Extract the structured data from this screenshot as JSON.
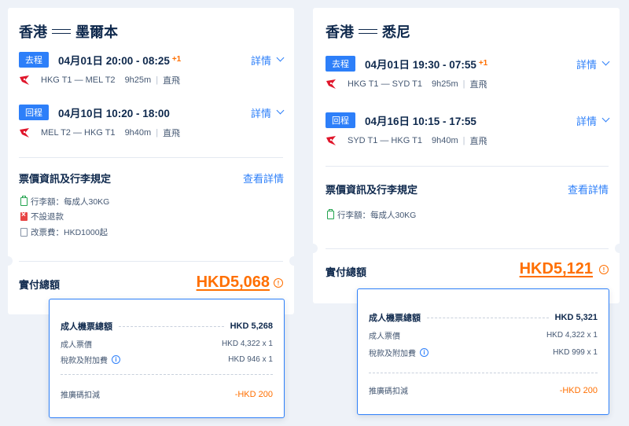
{
  "colors": {
    "accent_blue": "#2d7ff9",
    "price_orange": "#ff6f00",
    "text_dark": "#0f294d",
    "bag_green": "#23a34f",
    "no_refund_red": "#e84545"
  },
  "left": {
    "title_from": "香港",
    "title_to": "墨爾本",
    "segments": [
      {
        "tag": "去程",
        "time": "04月01日 20:00 - 08:25",
        "plus": "+1",
        "details": "詳情",
        "route": "HKG T1 — MEL T2",
        "duration": "9h25m",
        "nonstop": "直飛"
      },
      {
        "tag": "回程",
        "time": "04月10日 10:20 - 18:00",
        "plus": "",
        "details": "詳情",
        "route": "MEL T2 — HKG T1",
        "duration": "9h40m",
        "nonstop": "直飛"
      }
    ],
    "fare_title": "票價資訊及行李規定",
    "view_details": "查看詳情",
    "rules": [
      {
        "icon": "baggage-icon",
        "text": "行李額：每成人30KG"
      },
      {
        "icon": "no-refund-icon",
        "text": "不設退款"
      },
      {
        "icon": "change-fee-icon",
        "text": "改票費：HKD1000起"
      }
    ],
    "total_label": "實付總額",
    "total_amount": "HKD5,068",
    "popup": {
      "head_label": "成人機票總額",
      "head_value": "HKD 5,268",
      "fare_label": "成人票價",
      "fare_value": "HKD 4,322 x 1",
      "tax_label": "稅款及附加費",
      "tax_value": "HKD 946 x 1",
      "discount_label": "推廣碼扣減",
      "discount_value": "-HKD 200"
    }
  },
  "right": {
    "title_from": "香港",
    "title_to": "悉尼",
    "segments": [
      {
        "tag": "去程",
        "time": "04月01日 19:30 - 07:55",
        "plus": "+1",
        "details": "詳情",
        "route": "HKG T1 — SYD T1",
        "duration": "9h25m",
        "nonstop": "直飛"
      },
      {
        "tag": "回程",
        "time": "04月16日 10:15 - 17:55",
        "plus": "",
        "details": "詳情",
        "route": "SYD T1 — HKG T1",
        "duration": "9h40m",
        "nonstop": "直飛"
      }
    ],
    "fare_title": "票價資訊及行李規定",
    "view_details": "查看詳情",
    "rules": [
      {
        "icon": "baggage-icon",
        "text": "行李額：每成人30KG"
      }
    ],
    "total_label": "實付總額",
    "total_amount": "HKD5,121",
    "popup": {
      "head_label": "成人機票總額",
      "head_value": "HKD 5,321",
      "fare_label": "成人票價",
      "fare_value": "HKD 4,322 x 1",
      "tax_label": "稅款及附加費",
      "tax_value": "HKD 999 x 1",
      "discount_label": "推廣碼扣減",
      "discount_value": "-HKD 200"
    }
  }
}
